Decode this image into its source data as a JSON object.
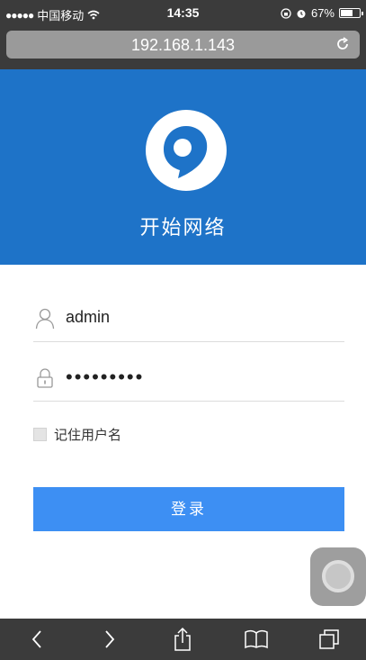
{
  "status": {
    "carrier": "中国移动",
    "time": "14:35",
    "battery_text": "67%",
    "battery_level": 0.67
  },
  "browser": {
    "url": "192.168.1.143"
  },
  "hero": {
    "title": "开始网络",
    "background": "#1e73c8"
  },
  "form": {
    "username_value": "admin",
    "password_value": "•••••••••",
    "remember_label": "记住用户名",
    "login_label": "登录",
    "button_color": "#3d8ff3"
  },
  "icons": [
    "user-icon",
    "lock-icon",
    "reload-icon",
    "back-icon",
    "forward-icon",
    "share-icon",
    "bookmarks-icon",
    "tabs-icon"
  ]
}
